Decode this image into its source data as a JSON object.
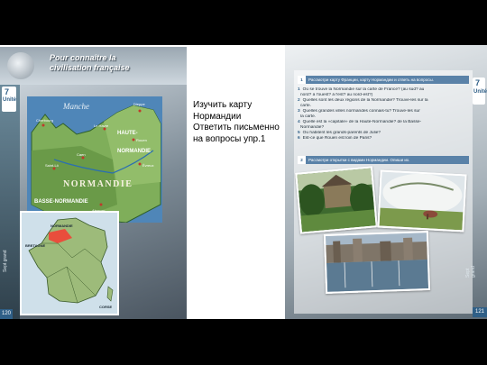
{
  "left_page": {
    "title": "Pour connaître la civilisation française",
    "unit_number": "7",
    "unit_word": "Unité",
    "page_number": "120",
    "side_label": "Sept grand",
    "map": {
      "sea_label": "Manche",
      "region_label": "NORMANDIE",
      "sub_regions": [
        "HAUTE-",
        "NORMANDIE",
        "BASSE-NORMANDIE"
      ],
      "cities": [
        "Cherbourg",
        "Dieppe",
        "Le Havre",
        "Rouen",
        "Caen",
        "Saint-Lô",
        "Alençon",
        "Évreux"
      ],
      "land_color": "#7fae5a",
      "sea_color": "#4f86b8"
    },
    "inset_map": {
      "labels": [
        "NORMANDIE",
        "BRETAGNE",
        "CORSE"
      ],
      "highlight_color": "#e94e3c"
    }
  },
  "center_text": {
    "lines": [
      "Изучить карту",
      "Нормандии",
      "Ответить письменно",
      "на вопросы упр.1"
    ]
  },
  "right_page": {
    "unit_number": "7",
    "unit_word": "Unité",
    "page_number": "121",
    "side_label": "Sept grand",
    "exercise1": {
      "num": "1",
      "heading": "Рассмотри карту Франции, карту Нормандии и ответь на вопросы."
    },
    "questions": [
      {
        "num": "1",
        "text": "Où se trouve la Normandie sur la carte de France? (au sud? au"
      },
      {
        "num": "",
        "text": "nord? à l'ouest? à l'est? au nord-est?)"
      },
      {
        "num": "2",
        "text": "Quelles sont les deux régions de la Normandie? Trouve-les sur la"
      },
      {
        "num": "",
        "text": "carte."
      },
      {
        "num": "3",
        "text": "Quelles grandes villes normandes connais-tu? Trouve-les sur"
      },
      {
        "num": "",
        "text": "la carte."
      },
      {
        "num": "4",
        "text": "Quelle est la «capitale» de la Haute-Normandie? de la Basse-"
      },
      {
        "num": "",
        "text": "Normandie?"
      },
      {
        "num": "5",
        "text": "Où habitent les grands-parents de Julie?"
      },
      {
        "num": "6",
        "text": "Est-ce que Rouen est loin de Paris?"
      }
    ],
    "exercise2": {
      "num": "2",
      "heading": "Рассмотри открытки с видами Нормандии. Опиши их."
    }
  }
}
